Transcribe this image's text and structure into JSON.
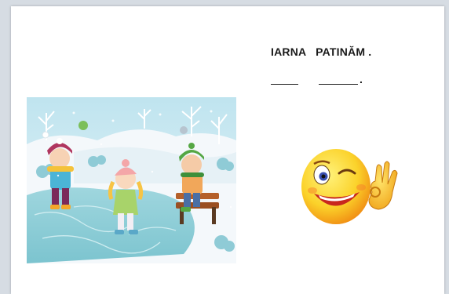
{
  "worksheet": {
    "sentence": "IARNA   PATINĂM .",
    "answer_dot": "."
  },
  "images": {
    "illustration": "children-ice-skating-winter-illustration",
    "emoji": "winking-smiley-ok-hand-emoji"
  },
  "colors": {
    "ice": "#a8dde2",
    "snow": "#f4f8fb",
    "emoji_yellow": "#fbd22a",
    "emoji_orange": "#f08a12",
    "text": "#1a1a1a"
  }
}
